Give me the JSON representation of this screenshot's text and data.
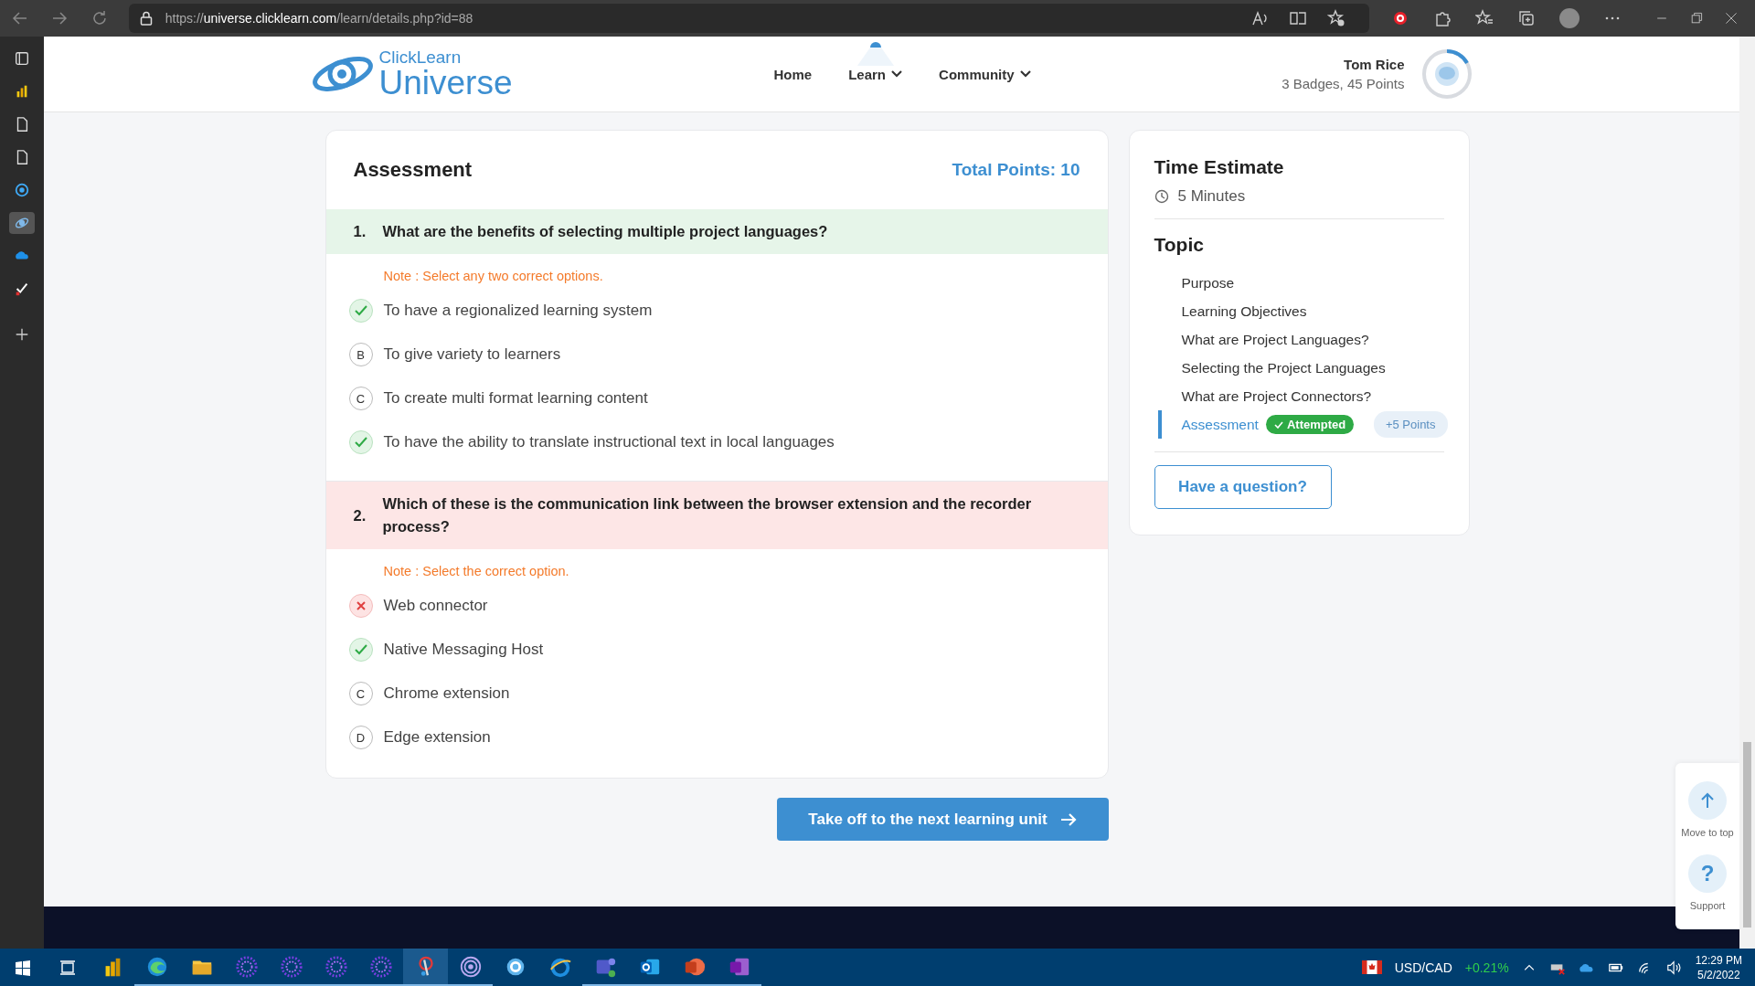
{
  "browser": {
    "url": "https://**universe.clicklearn.com**/learn/details.php?id=88"
  },
  "edge_sidebar": [
    {
      "kind": "tabs",
      "selected": false
    },
    {
      "kind": "chart",
      "selected": false
    },
    {
      "kind": "document",
      "selected": false
    },
    {
      "kind": "document",
      "selected": false
    },
    {
      "kind": "target",
      "selected": false
    },
    {
      "kind": "planet",
      "selected": true
    },
    {
      "kind": "cloud",
      "selected": false
    },
    {
      "kind": "check",
      "selected": false
    },
    {
      "kind": "plus",
      "selected": false
    }
  ],
  "header": {
    "logo_top": "ClickLearn",
    "logo_bottom": "Universe",
    "nav": [
      {
        "label": "Home",
        "selected": false,
        "dropdown": false
      },
      {
        "label": "Learn",
        "selected": true,
        "dropdown": true
      },
      {
        "label": "Community",
        "selected": false,
        "dropdown": true
      }
    ],
    "user": {
      "name": "Tom Rice",
      "stats": "3 Badges, 45 Points"
    }
  },
  "assessment": {
    "title": "Assessment",
    "total": "Total Points: 10",
    "questions": [
      {
        "number": "1.",
        "kind": "correct",
        "text": "What are the benefits of selecting multiple project languages?",
        "note": "Note : Select any two correct options.",
        "options": [
          {
            "kind": "correct",
            "text": "To have a regionalized learning system"
          },
          {
            "kind": "letter",
            "letter": "B",
            "text": "To give variety to learners"
          },
          {
            "kind": "letter",
            "letter": "C",
            "text": "To create multi format learning content"
          },
          {
            "kind": "correct",
            "text": "To have the ability to translate instructional text in local languages"
          }
        ]
      },
      {
        "number": "2.",
        "kind": "incorrect",
        "text": "Which of these is the communication link between the browser extension and the recorder process?",
        "note": "Note : Select the correct option.",
        "options": [
          {
            "kind": "wrong",
            "text": "Web connector"
          },
          {
            "kind": "correct",
            "text": "Native Messaging Host"
          },
          {
            "kind": "letter",
            "letter": "C",
            "text": "Chrome extension"
          },
          {
            "kind": "letter",
            "letter": "D",
            "text": "Edge extension"
          }
        ]
      }
    ]
  },
  "next_button": "Take off to the next learning unit",
  "sidebar": {
    "time_title": "Time Estimate",
    "time": "5 Minutes",
    "topic_title": "Topic",
    "topics": [
      {
        "label": "Purpose",
        "selected": false
      },
      {
        "label": "Learning Objectives",
        "selected": false
      },
      {
        "label": "What are Project Languages?",
        "selected": false
      },
      {
        "label": "Selecting the Project Languages",
        "selected": false
      },
      {
        "label": "What are Project Connectors?",
        "selected": false
      },
      {
        "label": "Assessment",
        "selected": true,
        "badge": "Attempted",
        "points": "+5 Points"
      }
    ],
    "question_button": "Have a question?"
  },
  "floating": {
    "top": "Move to top",
    "support_mark": "?",
    "support": "Support"
  },
  "taskbar": {
    "apps": [
      {
        "kind": "chart",
        "running": false,
        "selected": false
      },
      {
        "kind": "edge",
        "running": true,
        "selected": false
      },
      {
        "kind": "folder",
        "running": true,
        "selected": false
      },
      {
        "kind": "spiral",
        "running": true,
        "selected": false
      },
      {
        "kind": "spiral",
        "running": true,
        "selected": false
      },
      {
        "kind": "spiral",
        "running": true,
        "selected": false
      },
      {
        "kind": "spiral",
        "running": true,
        "selected": false
      },
      {
        "kind": "recorder",
        "running": true,
        "selected": true
      },
      {
        "kind": "target",
        "running": true,
        "selected": false
      },
      {
        "kind": "ring",
        "running": false,
        "selected": false
      },
      {
        "kind": "globe",
        "running": false,
        "selected": false
      },
      {
        "kind": "teams",
        "running": true,
        "selected": false
      },
      {
        "kind": "outlook",
        "running": true,
        "selected": false
      },
      {
        "kind": "powerpoint",
        "running": true,
        "selected": false
      },
      {
        "kind": "onenote",
        "running": true,
        "selected": false
      }
    ],
    "ticker": "USD/CAD",
    "change": "+0.21%",
    "time": "12:29 PM",
    "date": "5/2/2022"
  }
}
